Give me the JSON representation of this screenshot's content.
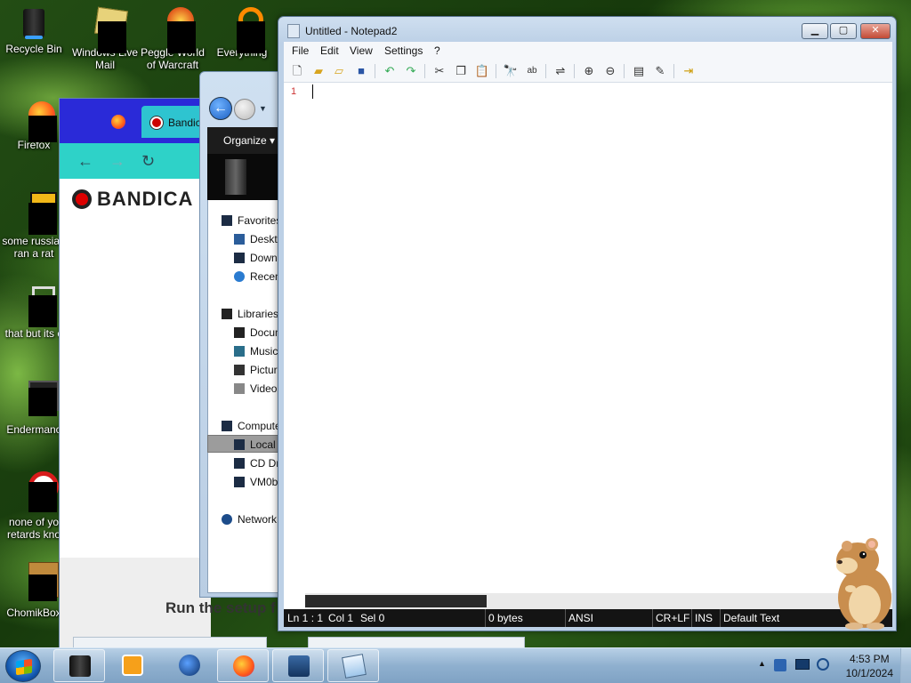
{
  "desktop": {
    "icons": [
      {
        "label": "Recycle Bin"
      },
      {
        "label": "Windows Live Mail"
      },
      {
        "label": "Peggle World of Warcraft"
      },
      {
        "label": "Everything"
      },
      {
        "label": "Firefox"
      },
      {
        "label": "some russian ran a rat"
      },
      {
        "label": "that but its c"
      },
      {
        "label": "Endermanc"
      },
      {
        "label": "none of yo retards kno"
      },
      {
        "label": "ChomikBox"
      }
    ]
  },
  "firefox": {
    "tab_label": "Bandic",
    "brand_text": "BANDICA",
    "setup_text": "Run the setup f"
  },
  "explorer": {
    "organize_label": "Organize ▾",
    "nav": [
      {
        "label": "Favorites",
        "icon": "star-icon"
      },
      {
        "label": "Desktop",
        "icon": "desktop-icon"
      },
      {
        "label": "Downloads",
        "icon": "downloads-icon"
      },
      {
        "label": "Recent Places",
        "icon": "recent-icon"
      },
      {
        "label": "Libraries",
        "icon": "library-icon"
      },
      {
        "label": "Documents",
        "icon": "documents-icon"
      },
      {
        "label": "Music",
        "icon": "music-icon"
      },
      {
        "label": "Pictures",
        "icon": "pictures-icon"
      },
      {
        "label": "Videos",
        "icon": "videos-icon"
      },
      {
        "label": "Computer",
        "icon": "computer-icon"
      },
      {
        "label": "Local Disk",
        "icon": "disk-icon"
      },
      {
        "label": "CD Drive",
        "icon": "cd-icon"
      },
      {
        "label": "VM0b",
        "icon": "drive-icon"
      },
      {
        "label": "Network",
        "icon": "network-icon"
      }
    ]
  },
  "notepad": {
    "title": "Untitled - Notepad2",
    "controls": {
      "minimize": "▁",
      "maximize": "▢",
      "close": "✕"
    },
    "menu": [
      "File",
      "Edit",
      "View",
      "Settings",
      "?"
    ],
    "line_number": "1",
    "status": {
      "position": "Ln 1 : 1",
      "column": "Col 1",
      "selection": "Sel 0",
      "size": "0 bytes",
      "encoding": "ANSI",
      "line_endings": "CR+LF",
      "mode": "INS",
      "scheme": "Default Text"
    }
  },
  "taskbar": {
    "time": "4:53 PM",
    "date": "10/1/2024"
  }
}
